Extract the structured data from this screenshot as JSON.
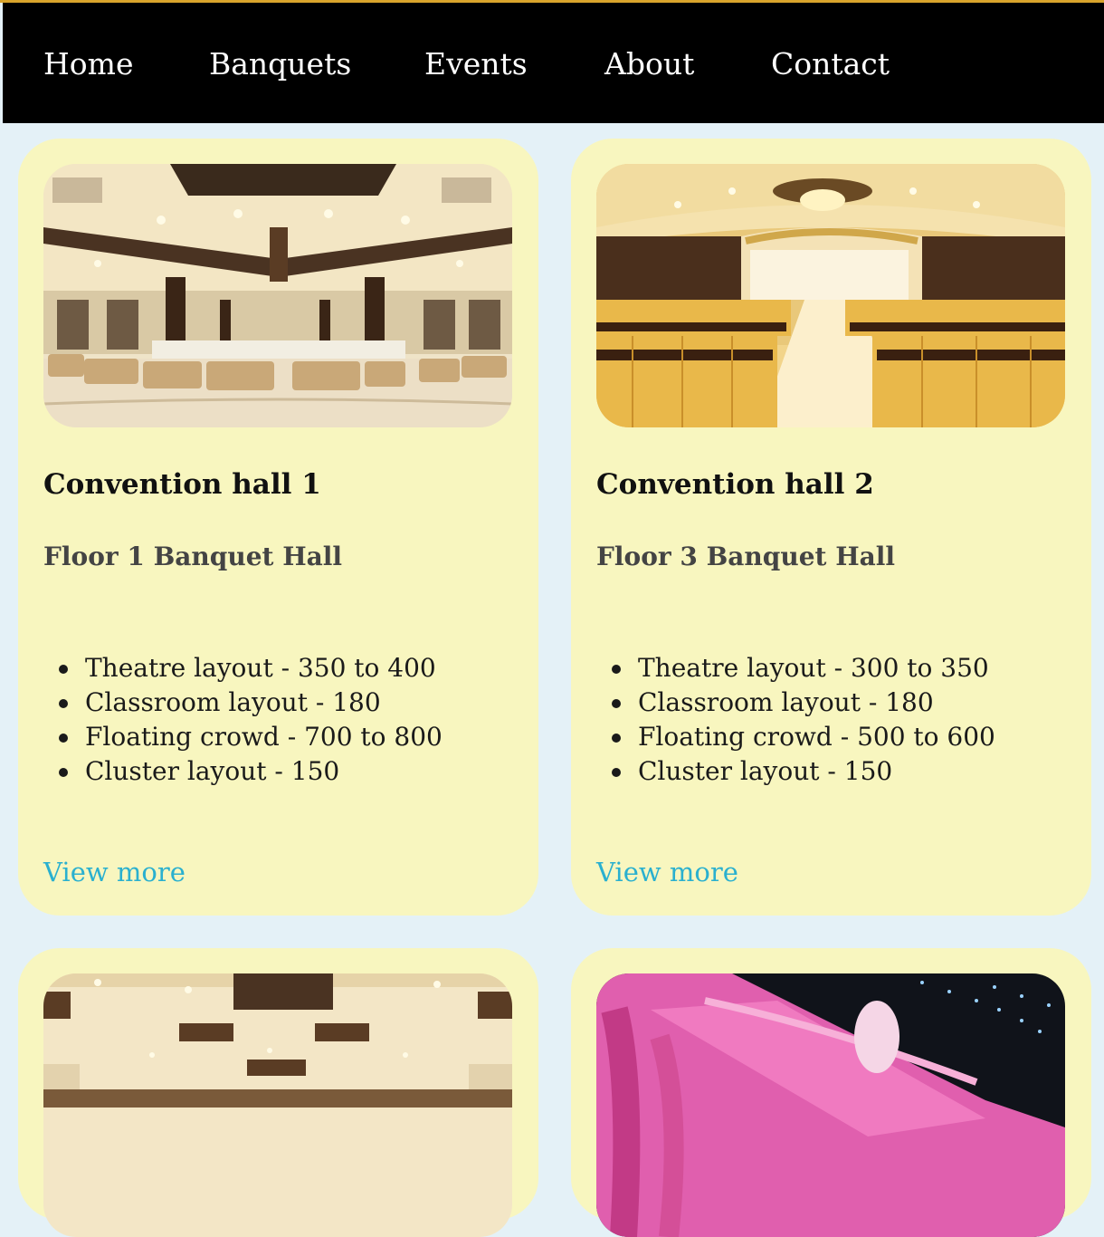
{
  "nav": {
    "items": [
      "Home",
      "Banquets",
      "Events",
      "About",
      "Contact"
    ]
  },
  "cards": [
    {
      "image": "hall-with-sofas-photo",
      "title": "Convention hall 1",
      "subtitle": "Floor 1 Banquet Hall",
      "features": [
        "Theatre layout - 350 to 400",
        "Classroom layout - 180",
        "Floating crowd - 700 to 800",
        "Cluster layout - 150"
      ],
      "link": "View more"
    },
    {
      "image": "hall-with-chair-rows-photo",
      "title": "Convention hall 2",
      "subtitle": "Floor 3 Banquet Hall",
      "features": [
        "Theatre layout - 300 to 350",
        "Classroom layout - 180",
        "Floating crowd - 500 to 600",
        "Cluster layout - 150"
      ],
      "link": "View more"
    },
    {
      "image": "hall-ceiling-photo"
    },
    {
      "image": "pink-decorated-lawn-photo"
    }
  ],
  "colors": {
    "page_background": "#e4f1f7",
    "nav_background": "#000000",
    "card_background": "#f8f6bf",
    "link": "#2ab0cf",
    "accent_line": "#d9a42c"
  }
}
